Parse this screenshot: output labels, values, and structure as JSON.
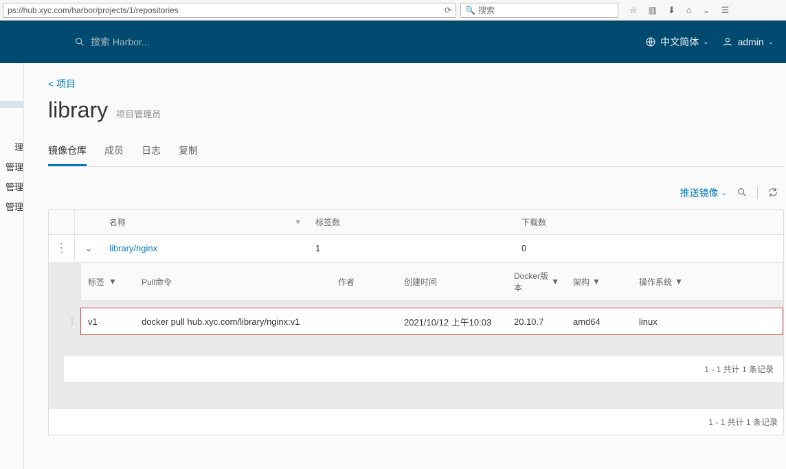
{
  "browser": {
    "url": "ps://hub.xyc.com/harbor/projects/1/repositories",
    "search_placeholder": "搜索"
  },
  "header": {
    "search_placeholder": "搜索 Harbor...",
    "language": "中文简体",
    "user": "admin"
  },
  "sidebar": {
    "items": [
      "",
      "理",
      "管理",
      "管理",
      "管理"
    ]
  },
  "breadcrumb": "< 项目",
  "project": {
    "name": "library",
    "role": "项目管理员"
  },
  "tabs": [
    {
      "label": "镜像仓库",
      "active": true
    },
    {
      "label": "成员",
      "active": false
    },
    {
      "label": "日志",
      "active": false
    },
    {
      "label": "复制",
      "active": false
    }
  ],
  "toolbar": {
    "push_label": "推送镜像"
  },
  "repo_table": {
    "columns": {
      "name": "名称",
      "tags": "标签数",
      "pulls": "下载数"
    },
    "rows": [
      {
        "name": "library/nginx",
        "tags": "1",
        "pulls": "0"
      }
    ],
    "footer": "1 - 1 共计 1 条记录"
  },
  "tag_table": {
    "columns": {
      "tag": "标签",
      "pull": "Pull命令",
      "author": "作者",
      "created": "创建时间",
      "docker": "Docker版本",
      "arch": "架构",
      "os": "操作系统"
    },
    "rows": [
      {
        "tag": "v1",
        "pull": "docker pull hub.xyc.com/library/nginx:v1",
        "author": "",
        "created": "2021/10/12 上午10:03",
        "docker": "20.10.7",
        "arch": "amd64",
        "os": "linux"
      }
    ],
    "footer": "1 - 1 共计 1 条记录"
  }
}
